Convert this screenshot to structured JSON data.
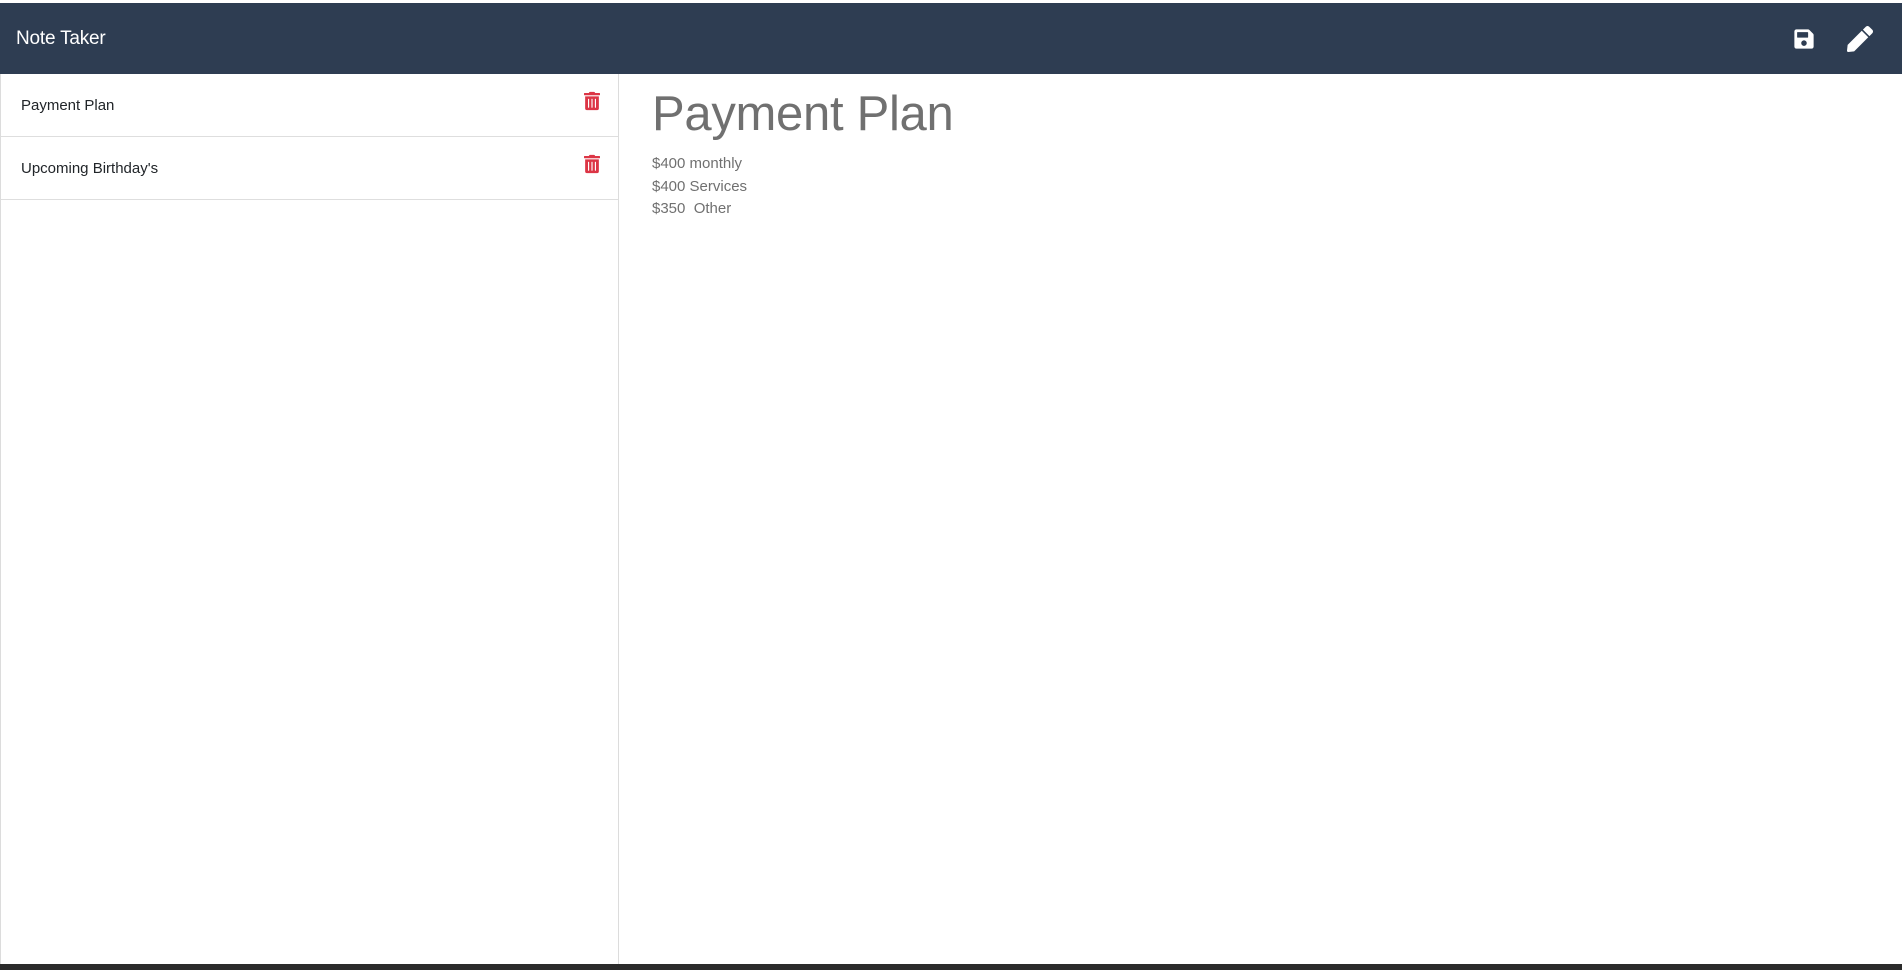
{
  "app": {
    "title": "Note Taker"
  },
  "header": {
    "icons": {
      "save": "save-icon",
      "edit": "pencil-icon"
    },
    "colors": {
      "background": "#2e3d52",
      "icon": "#ffffff"
    }
  },
  "sidebar": {
    "notes": [
      {
        "title": "Payment Plan",
        "icon": "trash-icon"
      },
      {
        "title": "Upcoming Birthday's",
        "icon": "trash-icon"
      }
    ],
    "delete_color": "#dc3545"
  },
  "active_note": {
    "title": "Payment Plan",
    "lines": [
      "$400 monthly",
      "$400 Services",
      "$350  Other"
    ]
  }
}
